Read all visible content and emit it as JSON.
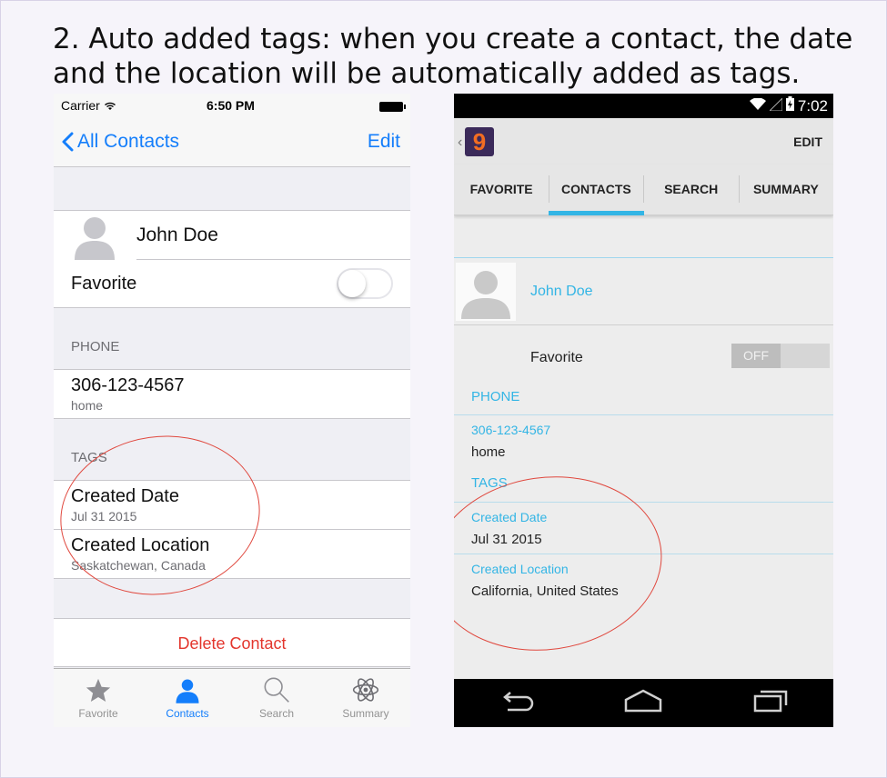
{
  "heading": "2. Auto added tags: when you create a contact, the date and the location will be automatically added as tags.",
  "ios": {
    "status": {
      "carrier": "Carrier",
      "time": "6:50 PM"
    },
    "nav": {
      "back_label": "All Contacts",
      "edit_label": "Edit"
    },
    "contact_name": "John Doe",
    "favorite_label": "Favorite",
    "favorite_on": false,
    "phone_header": "PHONE",
    "phone": {
      "number": "306-123-4567",
      "type": "home"
    },
    "tags_header": "TAGS",
    "tags": [
      {
        "label": "Created Date",
        "value": "Jul 31 2015"
      },
      {
        "label": "Created Location",
        "value": "Saskatchewan, Canada"
      }
    ],
    "delete_label": "Delete Contact",
    "tabbar": [
      {
        "label": "Favorite",
        "icon": "star-icon",
        "active": false
      },
      {
        "label": "Contacts",
        "icon": "person-icon",
        "active": true
      },
      {
        "label": "Search",
        "icon": "magnifier-icon",
        "active": false
      },
      {
        "label": "Summary",
        "icon": "atom-icon",
        "active": false
      }
    ],
    "accent_color": "#147efb",
    "destructive_color": "#e3362d"
  },
  "android": {
    "status": {
      "time": "7:02"
    },
    "app_logo_text": "9",
    "edit_label": "EDIT",
    "tabs": [
      {
        "label": "FAVORITE",
        "active": false
      },
      {
        "label": "CONTACTS",
        "active": true
      },
      {
        "label": "SEARCH",
        "active": false
      },
      {
        "label": "SUMMARY",
        "active": false
      }
    ],
    "contact_name": "John Doe",
    "favorite_label": "Favorite",
    "favorite_switch_label": "OFF",
    "phone_header": "PHONE",
    "phone": {
      "number": "306-123-4567",
      "type": "home"
    },
    "tags_header": "TAGS",
    "tags": [
      {
        "label": "Created Date",
        "value": "Jul 31 2015"
      },
      {
        "label": "Created Location",
        "value": "California, United States"
      }
    ],
    "navbar": [
      "back-icon",
      "home-icon",
      "recents-icon"
    ],
    "accent_color": "#33b5e5"
  },
  "annotation_color": "#e0483e"
}
